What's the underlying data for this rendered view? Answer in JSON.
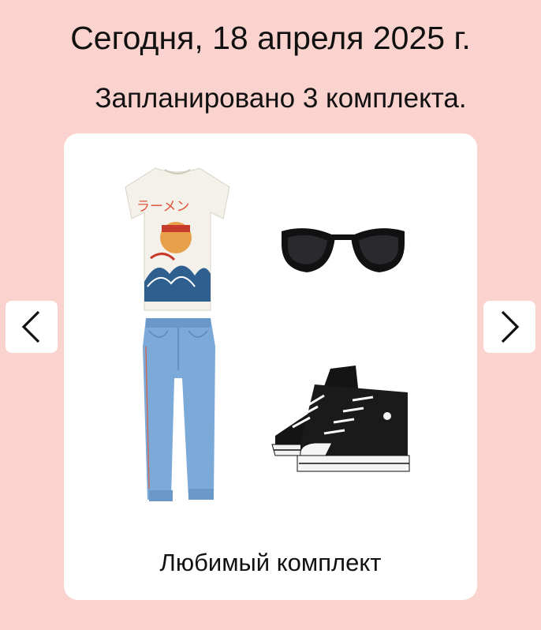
{
  "header": {
    "date_text": "Сегодня, 18 апреля 2025 г.",
    "planned_text": "Запланировано  3 комплекта."
  },
  "carousel": {
    "outfit_name": "Любимый комплект",
    "items": [
      {
        "kind": "t-shirt",
        "print_text": "ラーメン"
      },
      {
        "kind": "sunglasses"
      },
      {
        "kind": "jeans"
      },
      {
        "kind": "sneakers"
      }
    ],
    "prev_icon": "chevron-left-icon",
    "next_icon": "chevron-right-icon"
  },
  "colors": {
    "background": "#fad3cf",
    "card": "#ffffff",
    "text": "#111111"
  }
}
